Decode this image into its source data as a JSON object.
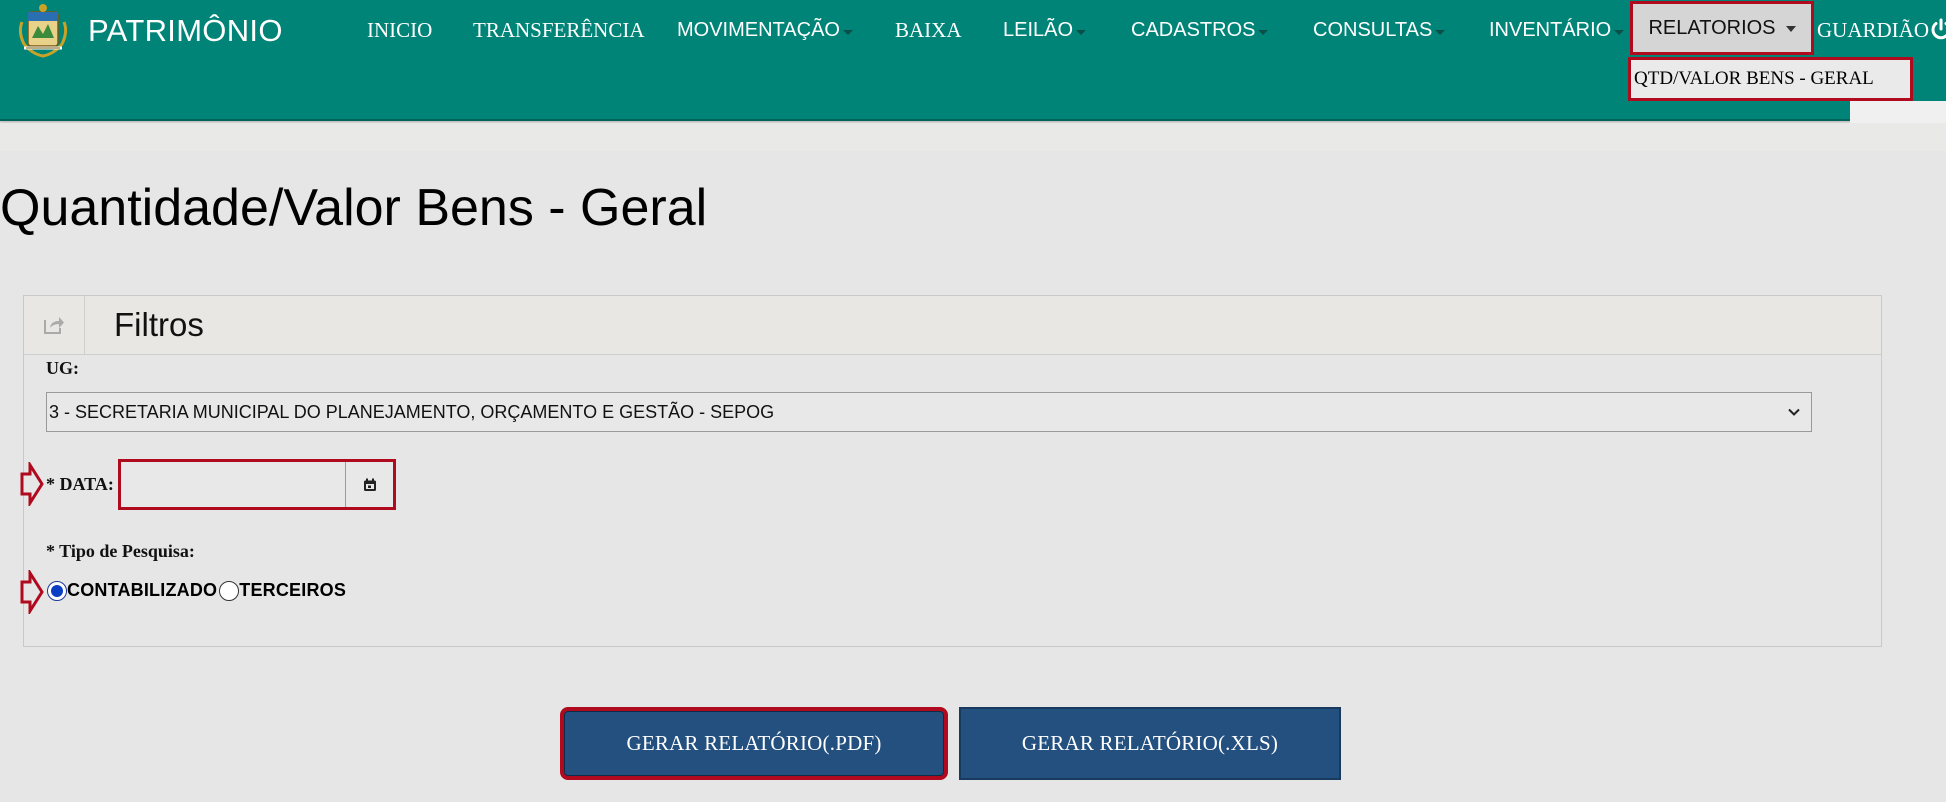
{
  "app": {
    "brand": "PATRIMÔNIO"
  },
  "nav": {
    "items": [
      {
        "label": "INICIO"
      },
      {
        "label": "TRANSFERÊNCIA"
      },
      {
        "label": "MOVIMENTAÇÃO"
      },
      {
        "label": "BAIXA"
      },
      {
        "label": "LEILÃO"
      },
      {
        "label": "CADASTROS"
      },
      {
        "label": "CONSULTAS"
      },
      {
        "label": "INVENTÁRIO"
      }
    ],
    "active": {
      "label": "RELATORIOS"
    },
    "dropdown": {
      "items": [
        {
          "label": "QTD/VALOR BENS - GERAL"
        }
      ]
    },
    "user": {
      "label": "GUARDIÃO"
    }
  },
  "page": {
    "title": "Quantidade/Valor Bens - Geral"
  },
  "filters": {
    "title": "Filtros",
    "ug": {
      "label": "UG:",
      "selected": "3 - SECRETARIA MUNICIPAL DO PLANEJAMENTO, ORÇAMENTO E GESTÃO - SEPOG"
    },
    "date": {
      "label": "* DATA:",
      "value": ""
    },
    "search_type": {
      "label": "* Tipo de Pesquisa:",
      "options": [
        {
          "label": "CONTABILIZADO",
          "checked": true
        },
        {
          "label": "TERCEIROS",
          "checked": false
        }
      ]
    }
  },
  "actions": {
    "pdf_label": "GERAR RELATÓRIO(.PDF)",
    "xls_label": "GERAR RELATÓRIO(.XLS)"
  },
  "colors": {
    "navbar": "#008478",
    "highlight": "#b00a1e",
    "button": "#23507f"
  }
}
